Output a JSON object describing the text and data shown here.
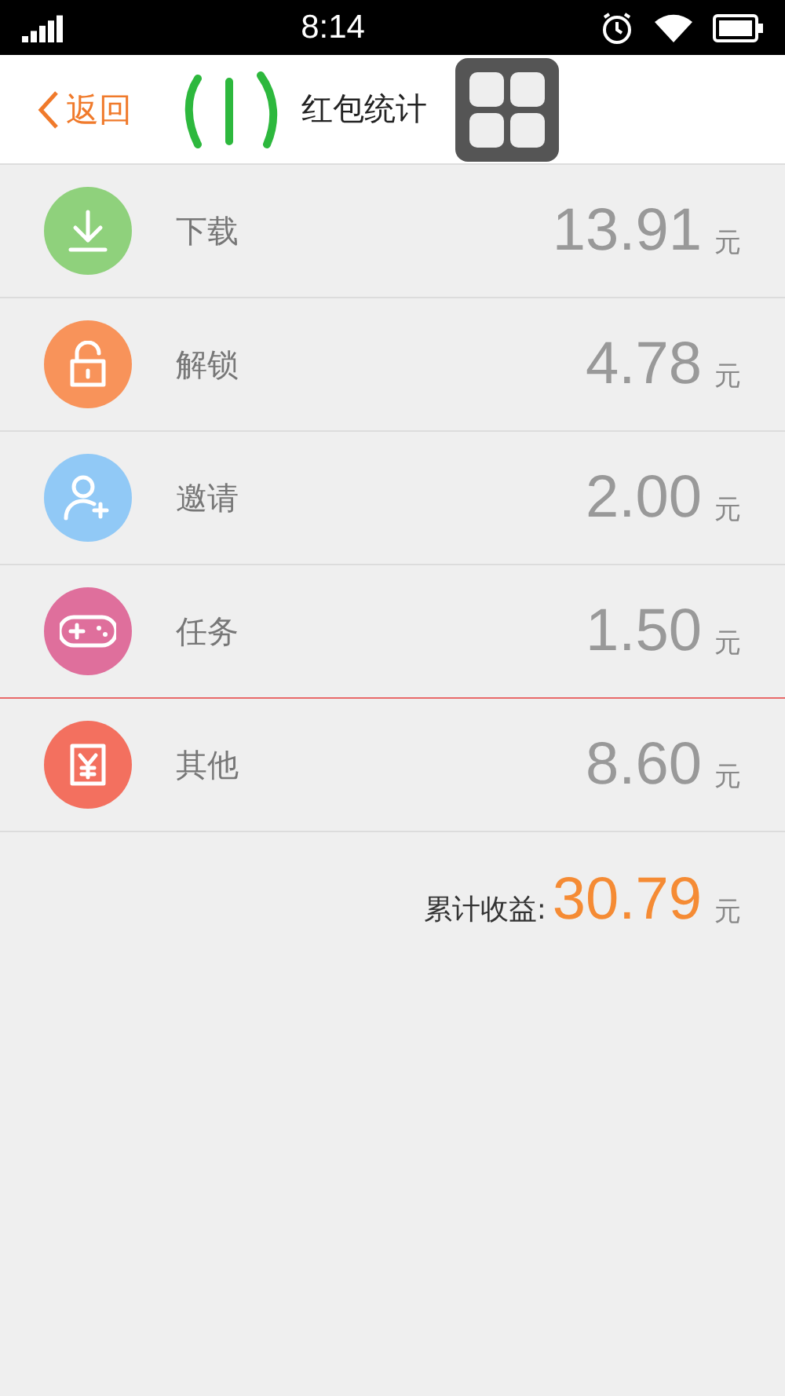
{
  "status_bar": {
    "time": "8:14"
  },
  "header": {
    "back": "返回",
    "title": "红包统计"
  },
  "rows": [
    {
      "kind": "download",
      "label": "下载",
      "amount": "13.91",
      "unit": "元",
      "color": "#8fd17c",
      "selected": false
    },
    {
      "kind": "unlock",
      "label": "解锁",
      "amount": "4.78",
      "unit": "元",
      "color": "#f8935a",
      "selected": false
    },
    {
      "kind": "invite",
      "label": "邀请",
      "amount": "2.00",
      "unit": "元",
      "color": "#91c9f6",
      "selected": false
    },
    {
      "kind": "game",
      "label": "任务",
      "amount": "1.50",
      "unit": "元",
      "color": "#df6f9c",
      "selected": true
    },
    {
      "kind": "other",
      "label": "其他",
      "amount": "8.60",
      "unit": "元",
      "color": "#f3705f",
      "selected": false
    }
  ],
  "total": {
    "label": "累计收益:",
    "amount": "30.79",
    "unit": "元"
  }
}
